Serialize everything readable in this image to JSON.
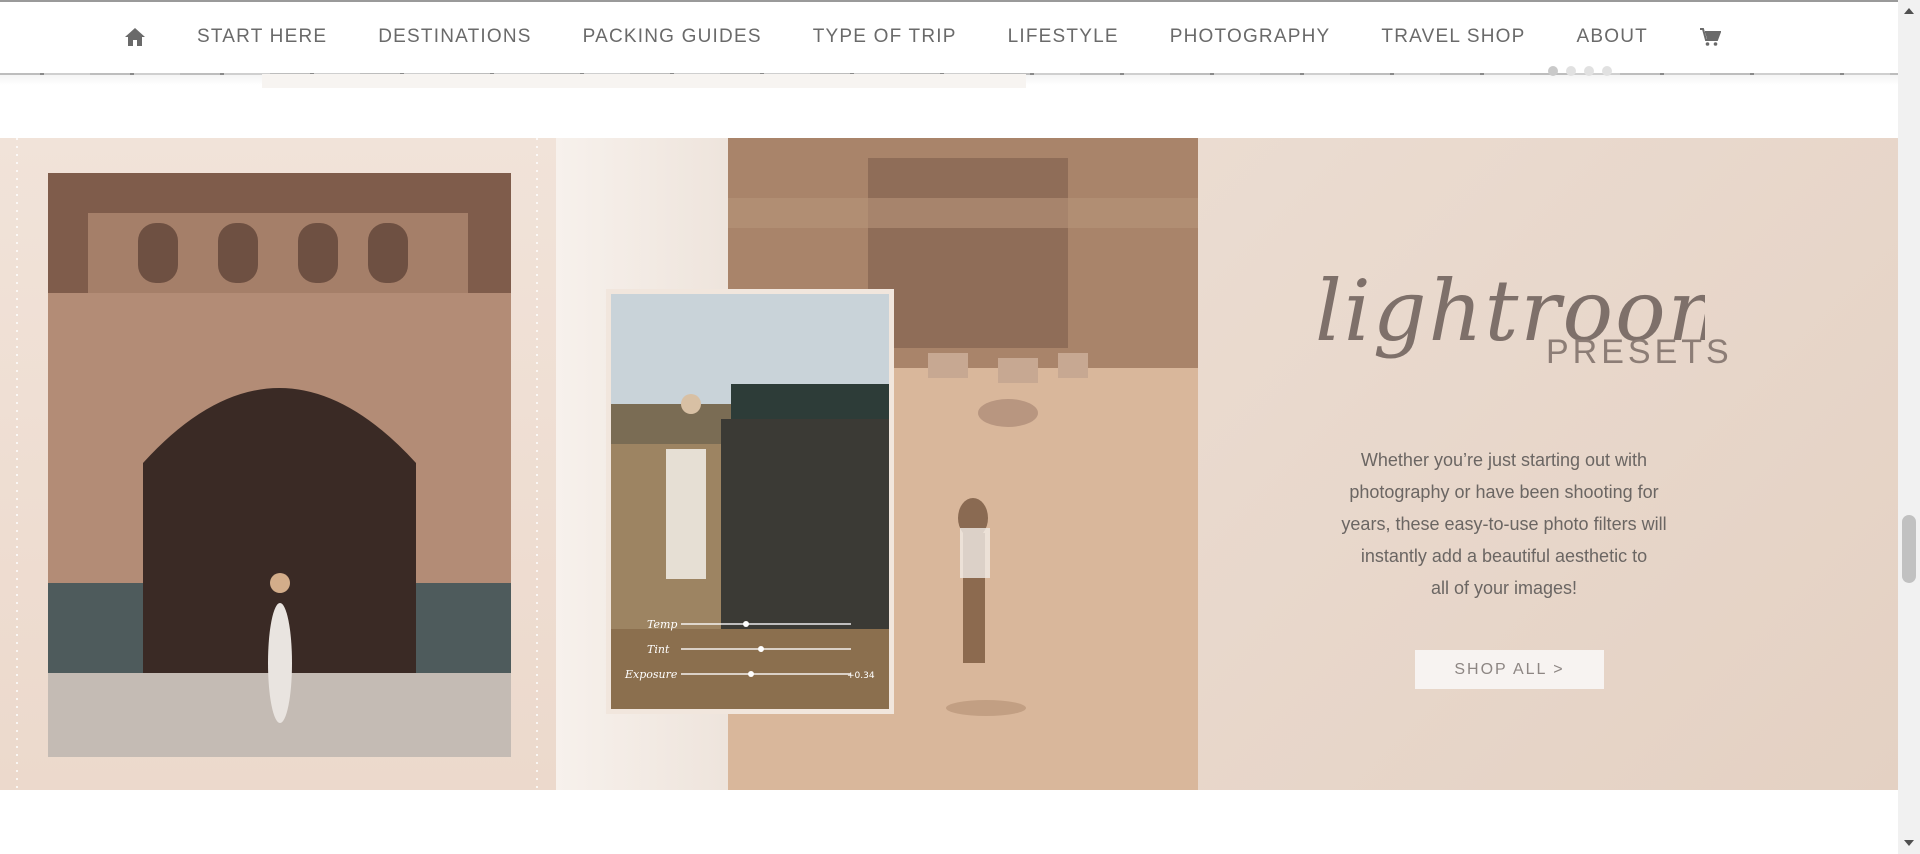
{
  "nav": {
    "items": [
      {
        "label": "START HERE"
      },
      {
        "label": "DESTINATIONS"
      },
      {
        "label": "PACKING GUIDES"
      },
      {
        "label": "TYPE OF TRIP"
      },
      {
        "label": "LIFESTYLE"
      },
      {
        "label": "PHOTOGRAPHY"
      },
      {
        "label": "TRAVEL SHOP"
      },
      {
        "label": "ABOUT"
      }
    ],
    "home_icon": "home-icon",
    "cart_icon": "cart-icon"
  },
  "carousel": {
    "dots": 4,
    "active_dot": 1
  },
  "banner": {
    "script_title": "lightroom",
    "subtitle": "PRESETS",
    "description_lines": [
      "Whether you’re just starting out with",
      "photography or have been shooting for",
      "years, these easy-to-use photo filters will",
      "instantly add a beautiful aesthetic to",
      "all of your images!"
    ],
    "button_label": "SHOP ALL >",
    "slider_labels": [
      "Temp",
      "Tint",
      "Exposure"
    ],
    "slider_value": "+0.34"
  },
  "colors": {
    "nav_text": "#6a6a6a",
    "banner_bg": "#ead9cd",
    "button_bg": "#f7f3f1"
  }
}
